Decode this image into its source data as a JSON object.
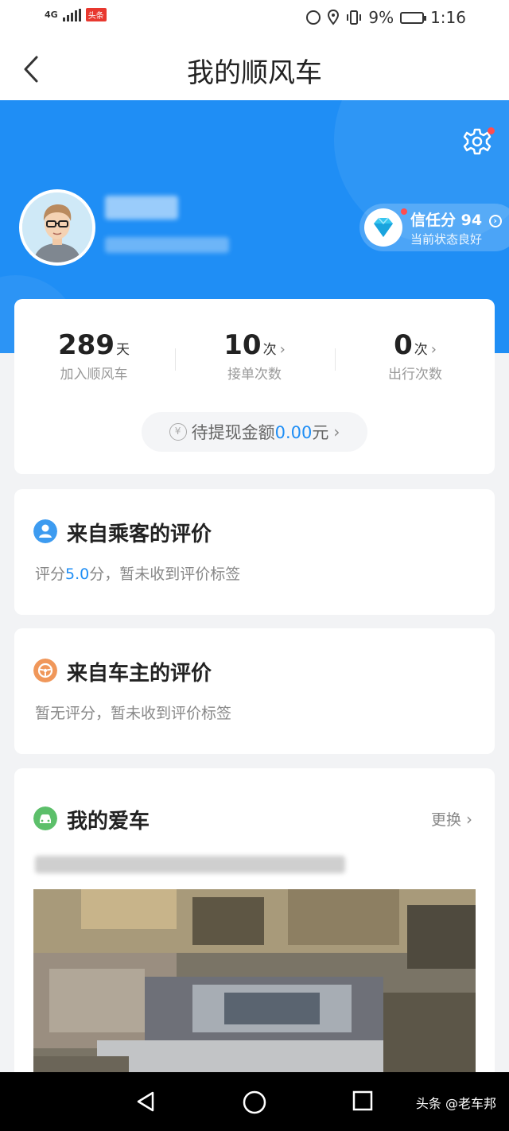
{
  "status_bar": {
    "network": "4G",
    "badge": "头条",
    "battery": "9%",
    "time": "1:16"
  },
  "nav": {
    "title": "我的顺风车"
  },
  "profile": {
    "trust_title": "信任分 94",
    "trust_status": "当前状态良好"
  },
  "stats": {
    "join": {
      "value": "289",
      "unit": "天",
      "label": "加入顺风车"
    },
    "orders": {
      "value": "10",
      "unit": "次",
      "label": "接单次数"
    },
    "trips": {
      "value": "0",
      "unit": "次",
      "label": "出行次数"
    },
    "withdraw_prefix": "待提现金额",
    "withdraw_amount": "0.00",
    "withdraw_unit": "元"
  },
  "passenger_review": {
    "title": "来自乘客的评价",
    "text_prefix": "评分",
    "score": "5.0",
    "text_suffix": "分，暂未收到评价标签"
  },
  "driver_review": {
    "title": "来自车主的评价",
    "text": "暂无评分，暂未收到评价标签"
  },
  "car": {
    "title": "我的爱车",
    "change": "更换"
  },
  "watermark": "头条 @老车邦",
  "colors": {
    "primary": "#1f8ef5",
    "passenger_icon": "#3d9bf0",
    "driver_icon": "#f0975a",
    "car_icon": "#5cbf6a"
  }
}
